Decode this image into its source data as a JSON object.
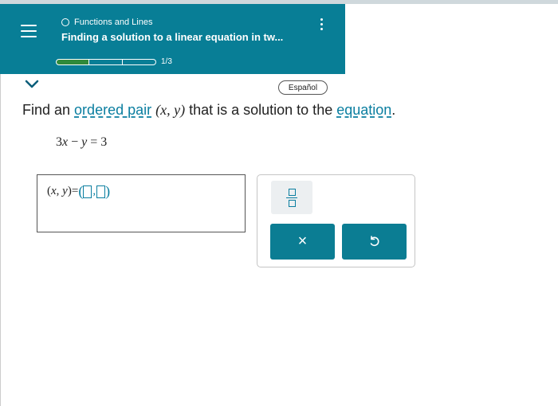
{
  "header": {
    "topic": "Functions and Lines",
    "title": "Finding a solution to a linear equation in tw...",
    "progress": {
      "label": "1/3",
      "completed": 1,
      "total": 3
    }
  },
  "language_button": "Español",
  "question": {
    "before": "Find an ",
    "link1": "ordered pair",
    "math": "(x, y)",
    "middle": " that is a solution to the ",
    "link2": "equation",
    "after": "."
  },
  "equation": {
    "lhs_coef": "3",
    "var1": "x",
    "minus": " − ",
    "var2": "y",
    "eq": " = ",
    "rhs": "3"
  },
  "answer": {
    "var1": "x",
    "var2": "y",
    "eq": " = "
  },
  "keypad": {
    "clear": "×",
    "undo": "↺"
  },
  "colors": {
    "header_bg": "#087e96",
    "accent": "#0a7ea0",
    "button_bg": "#0b7d93",
    "progress_fill": "#2f8a3a"
  }
}
